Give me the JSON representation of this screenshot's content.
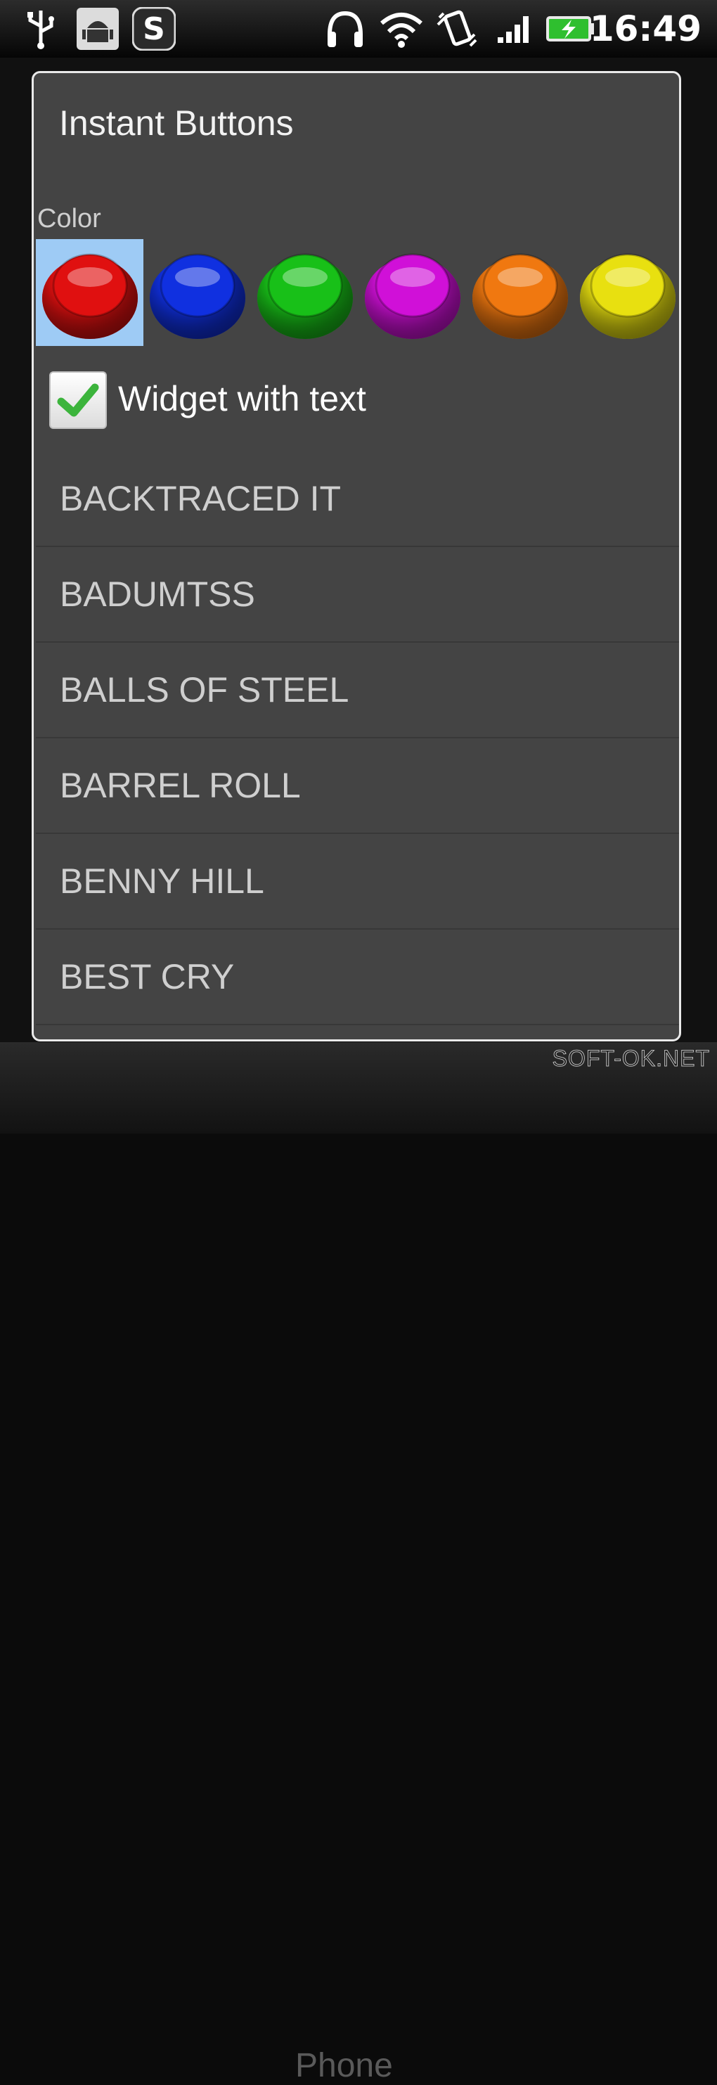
{
  "status_bar": {
    "time": "16:49",
    "icons": [
      "usb-icon",
      "android-debug-icon",
      "skype-icon",
      "headset-icon",
      "wifi-icon",
      "vibrate-icon",
      "signal-icon",
      "battery-charging-icon"
    ]
  },
  "background": {
    "dock_label": "Phone"
  },
  "dialog": {
    "title": "Instant Buttons",
    "color_label": "Color",
    "colors": [
      {
        "name": "red",
        "hex": "#e01010",
        "selected": true
      },
      {
        "name": "blue",
        "hex": "#1030e0",
        "selected": false
      },
      {
        "name": "green",
        "hex": "#18c018",
        "selected": false
      },
      {
        "name": "magenta",
        "hex": "#d010d8",
        "selected": false
      },
      {
        "name": "orange",
        "hex": "#f07810",
        "selected": false
      },
      {
        "name": "yellow",
        "hex": "#e8e010",
        "selected": false
      }
    ],
    "selection_color": "#9ecbf5",
    "checkbox": {
      "label": "Widget with text",
      "checked": true
    },
    "items": [
      "BACKTRACED IT",
      "BADUMTSS",
      "BALLS OF STEEL",
      "BARREL ROLL",
      "BENNY HILL",
      "BEST CRY"
    ]
  },
  "watermark": "SOFT-OK.NET"
}
